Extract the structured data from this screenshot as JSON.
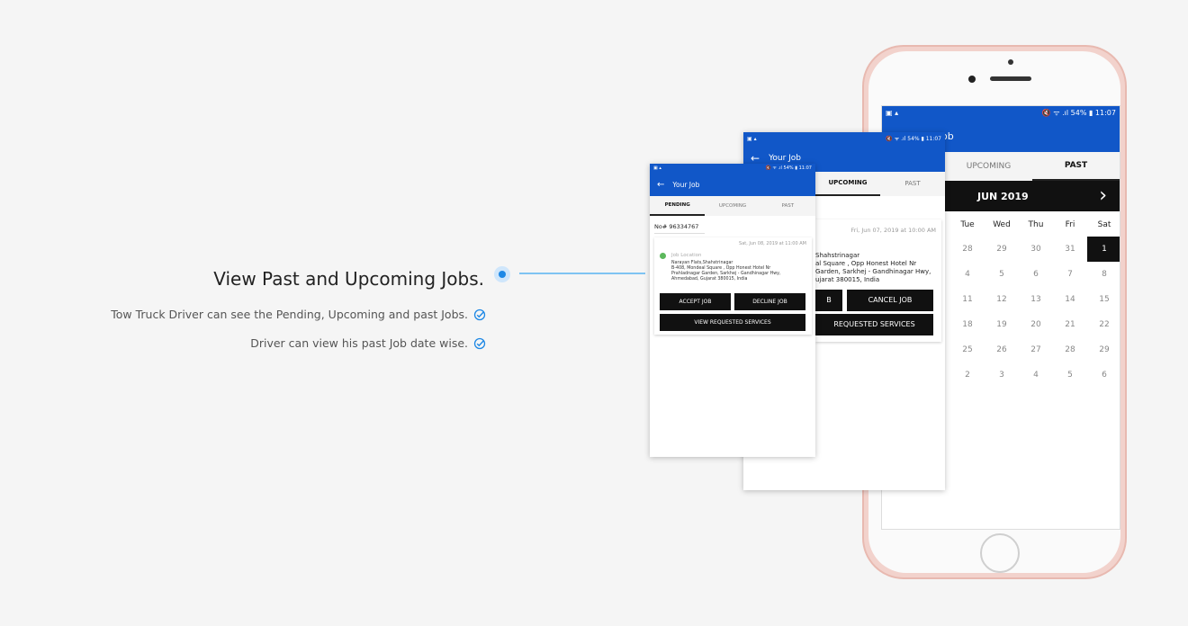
{
  "feature": {
    "title": "View Past and Upcoming Jobs.",
    "bullets": [
      "Tow Truck Driver can see the Pending, Upcoming and past Jobs.",
      "Driver can view his past Job date wise."
    ]
  },
  "status": {
    "left": "▣ ▴",
    "right": "🔇 ᯤ .ıl 54% ▮ 11:07"
  },
  "app": {
    "title": "Your Job",
    "back_icon": "←"
  },
  "tabs": [
    "PENDING",
    "UPCOMING",
    "PAST"
  ],
  "calendar": {
    "month": "JUN 2019",
    "next_icon": "›",
    "weekdays": [
      "Tue",
      "Wed",
      "Thu",
      "Fri",
      "Sat"
    ],
    "rows": [
      [
        "28",
        "29",
        "30",
        "31",
        "1"
      ],
      [
        "4",
        "5",
        "6",
        "7",
        "8"
      ],
      [
        "11",
        "12",
        "13",
        "14",
        "15"
      ],
      [
        "18",
        "19",
        "20",
        "21",
        "22"
      ],
      [
        "25",
        "26",
        "27",
        "28",
        "29"
      ],
      [
        "2",
        "3",
        "4",
        "5",
        "6"
      ]
    ],
    "selected": "1"
  },
  "upcoming_card": {
    "date": "Fri, Jun 07, 2019 at 10:00 AM",
    "address": [
      "Shahstrinagar",
      "al Square , Opp Honest Hotel Nr",
      "Garden, Sarkhej - Gandhinagar Hwy,",
      "ujarat 380015, India"
    ],
    "btn_left": "B",
    "btn_cancel": "CANCEL JOB",
    "btn_services": "REQUESTED SERVICES"
  },
  "pending_card": {
    "job_no": "No# 96334767",
    "date": "Sat, Jun 08, 2019 at 11:00 AM",
    "location_label": "Job Location",
    "address": [
      "Narayan Flats,Shahstrinagar",
      "B-408, Mondeal Square , Opp Honest Hotel Nr",
      "Prahladnagar Garden, Sarkhej - Gandhinagar Hwy,",
      "Ahmedabad, Gujarat 380015, India"
    ],
    "btn_accept": "ACCEPT JOB",
    "btn_decline": "DECLINE JOB",
    "btn_services": "VIEW REQUESTED SERVICES"
  },
  "colors": {
    "brand_blue": "#1157c8",
    "accent_blue": "#1e88e5",
    "location_dot": "#5cb85c"
  }
}
